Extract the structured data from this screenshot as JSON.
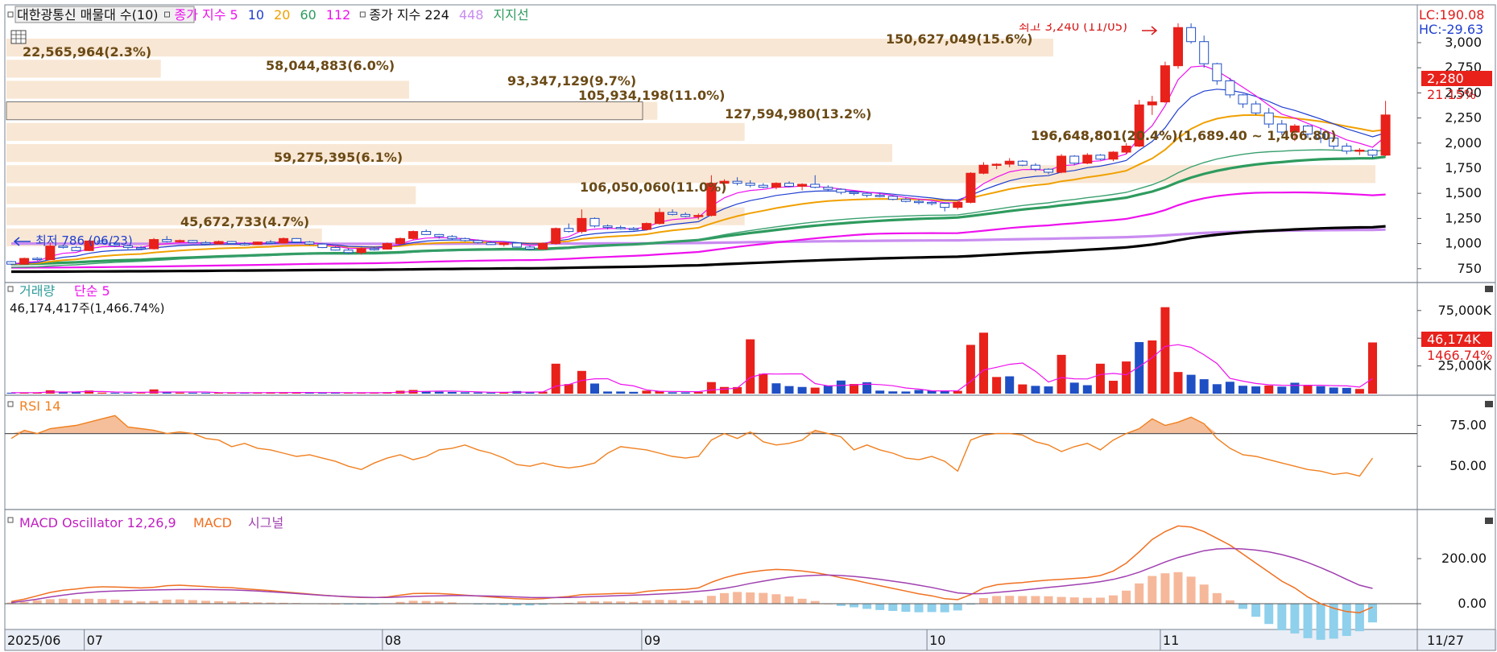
{
  "colors": {
    "up": "#e8211b",
    "down": "#1f4fc4",
    "pink": "#ee11ee",
    "blue": "#1f3fd0",
    "orange": "#f0a000",
    "green": "#2e9b5e",
    "green2": "#3aa070",
    "purple": "#c98cf0",
    "black": "#000000",
    "rsi": "#f08020",
    "macd": "#f07020",
    "signal": "#a040b0",
    "osc_pos": "#f6b89a",
    "osc_neg": "#8fd0ec",
    "box": "#f7e4cf",
    "boxtext": "#6b4a16"
  },
  "header": {
    "items": [
      {
        "text": "대한광통신 매물대 수(10)",
        "color": "#111111"
      },
      {
        "text": "종가 지수 5",
        "color": "#ee11ee"
      },
      {
        "text": "10",
        "color": "#1f3fd0"
      },
      {
        "text": "20",
        "color": "#f0a000"
      },
      {
        "text": "60",
        "color": "#2e9b5e"
      },
      {
        "text": "112",
        "color": "#ee11ee"
      },
      {
        "text": "종가 지수 224",
        "color": "#111111"
      },
      {
        "text": "448",
        "color": "#c98cf0"
      },
      {
        "text": "지지선",
        "color": "#2e9b5e"
      }
    ]
  },
  "right_labels": {
    "lc": "LC:190.08",
    "hc": "HC:-29.63",
    "last_price": "2,280",
    "last_change": "21.15%",
    "vol_last": "46,174K",
    "vol_pct": "1466.74%"
  },
  "price_axis": {
    "ticks": [
      {
        "v": 3000,
        "label": "3,000"
      },
      {
        "v": 2750,
        "label": "2,750"
      },
      {
        "v": 2500,
        "label": "2,500"
      },
      {
        "v": 2250,
        "label": "2,250"
      },
      {
        "v": 2000,
        "label": "2,000"
      },
      {
        "v": 1750,
        "label": "1,750"
      },
      {
        "v": 1500,
        "label": "1,500"
      },
      {
        "v": 1250,
        "label": "1,250"
      },
      {
        "v": 1000,
        "label": "1,000"
      },
      {
        "v": 750,
        "label": "750"
      }
    ]
  },
  "annotations": {
    "high": "최고 3,240 (11/05)",
    "low": "최저 786 (06/23)",
    "support": "196,648,801(20.4%)(1,689.40 ~ 1,466.80)"
  },
  "volume_profile": [
    {
      "label": "150,627,049(15.6%)",
      "pct": 15.6
    },
    {
      "label": "22,565,964(2.3%)",
      "pct": 2.3
    },
    {
      "label": "58,044,883(6.0%)",
      "pct": 6.0
    },
    {
      "label": "93,347,129(9.7%)",
      "pct": 9.7
    },
    {
      "label": "105,934,198(11.0%)",
      "pct": 11.0
    },
    {
      "label": "127,594,980(13.2%)",
      "pct": 13.2
    },
    {
      "label": "196,648,801(20.4%)",
      "pct": 20.4
    },
    {
      "label": "59,275,395(6.1%)",
      "pct": 6.1
    },
    {
      "label": "106,050,060(11.0%)",
      "pct": 11.0
    },
    {
      "label": "45,672,733(4.7%)",
      "pct": 4.7
    }
  ],
  "volume_panel": {
    "title": "거래량",
    "ma": "단순 5",
    "info": "46,174,417주(1,466.74%)",
    "ticks": [
      {
        "v": 75000,
        "label": "75,000K"
      },
      {
        "v": 50000,
        "label": "50,000K"
      },
      {
        "v": 25000,
        "label": "25,000K"
      }
    ]
  },
  "rsi_panel": {
    "title": "RSI 14",
    "ticks": [
      {
        "v": 75,
        "label": "75.00"
      },
      {
        "v": 50,
        "label": "50.00"
      }
    ]
  },
  "macd_panel": {
    "title": "MACD Oscillator 12,26,9",
    "macd": "MACD",
    "signal": "시그널",
    "ticks": [
      {
        "v": 200,
        "label": "200.00"
      },
      {
        "v": 0,
        "label": "0.00"
      }
    ]
  },
  "x_axis": {
    "labels": [
      {
        "i": 0,
        "label": "2025/06"
      },
      {
        "i": 6,
        "label": "07"
      },
      {
        "i": 29,
        "label": "08"
      },
      {
        "i": 49,
        "label": "09"
      },
      {
        "i": 71,
        "label": "10"
      },
      {
        "i": 89,
        "label": "11"
      }
    ],
    "end_label": "11/27"
  },
  "chart_data": {
    "type": "candlestick",
    "title": "대한광통신",
    "x_start": "2025/06",
    "x_end": "11/27",
    "ylim": [
      620,
      3200
    ],
    "candles": [
      [
        820,
        826,
        785,
        795
      ],
      [
        795,
        860,
        790,
        852
      ],
      [
        852,
        865,
        830,
        840
      ],
      [
        840,
        1010,
        835,
        975
      ],
      [
        975,
        990,
        950,
        962
      ],
      [
        962,
        975,
        925,
        930
      ],
      [
        930,
        1035,
        925,
        1025
      ],
      [
        1025,
        1040,
        1000,
        1005
      ],
      [
        1005,
        1015,
        965,
        978
      ],
      [
        978,
        990,
        945,
        960
      ],
      [
        960,
        975,
        935,
        948
      ],
      [
        948,
        1055,
        940,
        1040
      ],
      [
        1040,
        1075,
        1010,
        1020
      ],
      [
        1020,
        1040,
        1010,
        1030
      ],
      [
        1030,
        1035,
        1005,
        1010
      ],
      [
        1010,
        1025,
        990,
        996
      ],
      [
        996,
        1030,
        990,
        1020
      ],
      [
        1020,
        1025,
        995,
        1000
      ],
      [
        1000,
        1015,
        980,
        990
      ],
      [
        990,
        1020,
        985,
        1015
      ],
      [
        1015,
        1035,
        1000,
        1005
      ],
      [
        1005,
        1060,
        1000,
        1050
      ],
      [
        1050,
        1055,
        1010,
        1015
      ],
      [
        1015,
        1025,
        985,
        995
      ],
      [
        995,
        1000,
        955,
        960
      ],
      [
        960,
        970,
        930,
        935
      ],
      [
        935,
        950,
        900,
        910
      ],
      [
        910,
        960,
        890,
        950
      ],
      [
        950,
        960,
        930,
        945
      ],
      [
        945,
        1010,
        940,
        1000
      ],
      [
        1000,
        1060,
        990,
        1050
      ],
      [
        1050,
        1130,
        1040,
        1120
      ],
      [
        1120,
        1140,
        1085,
        1090
      ],
      [
        1090,
        1095,
        1050,
        1070
      ],
      [
        1070,
        1085,
        1040,
        1050
      ],
      [
        1050,
        1060,
        1020,
        1030
      ],
      [
        1030,
        1040,
        1000,
        1010
      ],
      [
        1010,
        1020,
        985,
        990
      ],
      [
        990,
        1015,
        970,
        1005
      ],
      [
        1005,
        1010,
        960,
        965
      ],
      [
        965,
        980,
        935,
        945
      ],
      [
        945,
        1010,
        940,
        1000
      ],
      [
        1000,
        1160,
        990,
        1150
      ],
      [
        1150,
        1200,
        1110,
        1120
      ],
      [
        1120,
        1340,
        1100,
        1250
      ],
      [
        1250,
        1260,
        1160,
        1175
      ],
      [
        1175,
        1190,
        1140,
        1160
      ],
      [
        1160,
        1180,
        1140,
        1150
      ],
      [
        1150,
        1165,
        1130,
        1140
      ],
      [
        1140,
        1210,
        1130,
        1200
      ],
      [
        1200,
        1350,
        1190,
        1310
      ],
      [
        1310,
        1340,
        1280,
        1290
      ],
      [
        1290,
        1310,
        1260,
        1270
      ],
      [
        1270,
        1300,
        1240,
        1280
      ],
      [
        1280,
        1680,
        1270,
        1600
      ],
      [
        1600,
        1640,
        1550,
        1620
      ],
      [
        1620,
        1660,
        1580,
        1600
      ],
      [
        1600,
        1630,
        1560,
        1580
      ],
      [
        1580,
        1600,
        1550,
        1560
      ],
      [
        1560,
        1610,
        1540,
        1600
      ],
      [
        1600,
        1620,
        1560,
        1570
      ],
      [
        1570,
        1600,
        1530,
        1590
      ],
      [
        1590,
        1680,
        1550,
        1560
      ],
      [
        1560,
        1580,
        1520,
        1540
      ],
      [
        1540,
        1550,
        1490,
        1510
      ],
      [
        1510,
        1520,
        1480,
        1500
      ],
      [
        1500,
        1510,
        1460,
        1480
      ],
      [
        1480,
        1500,
        1460,
        1470
      ],
      [
        1470,
        1480,
        1430,
        1440
      ],
      [
        1440,
        1460,
        1410,
        1420
      ],
      [
        1420,
        1440,
        1390,
        1410
      ],
      [
        1410,
        1420,
        1380,
        1400
      ],
      [
        1400,
        1410,
        1320,
        1360
      ],
      [
        1360,
        1420,
        1340,
        1410
      ],
      [
        1410,
        1710,
        1400,
        1700
      ],
      [
        1700,
        1810,
        1690,
        1780
      ],
      [
        1780,
        1800,
        1740,
        1790
      ],
      [
        1790,
        1850,
        1760,
        1820
      ],
      [
        1820,
        1830,
        1770,
        1780
      ],
      [
        1780,
        1800,
        1720,
        1740
      ],
      [
        1740,
        1750,
        1690,
        1710
      ],
      [
        1710,
        1890,
        1700,
        1870
      ],
      [
        1870,
        1880,
        1780,
        1800
      ],
      [
        1800,
        1900,
        1790,
        1880
      ],
      [
        1880,
        1890,
        1830,
        1840
      ],
      [
        1840,
        1920,
        1820,
        1910
      ],
      [
        1910,
        2000,
        1890,
        1970
      ],
      [
        1970,
        2430,
        1960,
        2380
      ],
      [
        2380,
        2470,
        2280,
        2410
      ],
      [
        2410,
        2810,
        2400,
        2770
      ],
      [
        2770,
        3240,
        2740,
        3150
      ],
      [
        3150,
        3260,
        2990,
        3010
      ],
      [
        3010,
        3070,
        2750,
        2790
      ],
      [
        2790,
        2800,
        2580,
        2620
      ],
      [
        2620,
        2650,
        2450,
        2480
      ],
      [
        2480,
        2490,
        2350,
        2390
      ],
      [
        2390,
        2420,
        2280,
        2300
      ],
      [
        2300,
        2350,
        2150,
        2190
      ],
      [
        2190,
        2230,
        2080,
        2110
      ],
      [
        2110,
        2190,
        2020,
        2170
      ],
      [
        2170,
        2180,
        2050,
        2090
      ],
      [
        2090,
        2150,
        2000,
        2050
      ],
      [
        2050,
        2060,
        1940,
        1970
      ],
      [
        1970,
        2000,
        1890,
        1920
      ],
      [
        1920,
        1950,
        1880,
        1930
      ],
      [
        1930,
        1940,
        1850,
        1880
      ],
      [
        1880,
        2420,
        1870,
        2280
      ]
    ],
    "volume_k": [
      800,
      1000,
      900,
      3000,
      1400,
      1200,
      2800,
      900,
      800,
      700,
      600,
      3800,
      1200,
      900,
      800,
      700,
      1000,
      900,
      700,
      1100,
      900,
      1200,
      1100,
      900,
      800,
      700,
      700,
      900,
      800,
      1300,
      2600,
      3300,
      2200,
      1700,
      1500,
      1200,
      1000,
      900,
      1300,
      2300,
      1400,
      1800,
      27000,
      8600,
      20500,
      9100,
      1900,
      1900,
      1600,
      2700,
      2300,
      1200,
      1100,
      1500,
      10400,
      6000,
      5900,
      49000,
      17900,
      9300,
      6800,
      6000,
      5400,
      7200,
      11800,
      8700,
      10300,
      2700,
      2000,
      1900,
      3300,
      2700,
      2300,
      2500,
      44000,
      55000,
      15000,
      15600,
      8300,
      7000,
      6500,
      35000,
      9900,
      7600,
      27000,
      11600,
      29000,
      46500,
      48000,
      78000,
      19500,
      17000,
      13000,
      8500,
      10700,
      7100,
      6500,
      7300,
      6300,
      9800,
      7800,
      6700,
      5500,
      5200,
      4200,
      46174
    ],
    "volume_down_indices": [
      0,
      4,
      5,
      8,
      9,
      12,
      14,
      15,
      18,
      23,
      24,
      25,
      32,
      33,
      34,
      35,
      36,
      37,
      39,
      40,
      45,
      46,
      47,
      48,
      51,
      52,
      59,
      60,
      61,
      63,
      64,
      66,
      67,
      68,
      69,
      70,
      71,
      72,
      77,
      79,
      80,
      82,
      83,
      87,
      91,
      92,
      93,
      94,
      95,
      96,
      98,
      99,
      101,
      102,
      103
    ],
    "rsi": [
      67,
      72,
      70,
      73,
      74,
      75,
      77,
      79,
      81,
      74,
      73,
      72,
      70,
      71,
      70,
      67,
      66,
      62,
      64,
      61,
      60,
      58,
      56,
      57,
      55,
      53,
      50,
      48,
      52,
      55,
      57,
      54,
      56,
      60,
      61,
      63,
      60,
      58,
      55,
      51,
      50,
      52,
      50,
      49,
      50,
      52,
      58,
      62,
      61,
      60,
      58,
      56,
      55,
      56,
      66,
      70,
      67,
      71,
      65,
      63,
      64,
      66,
      72,
      70,
      68,
      60,
      63,
      60,
      58,
      55,
      54,
      56,
      53,
      47,
      66,
      69,
      70,
      70,
      69,
      65,
      63,
      59,
      62,
      64,
      60,
      66,
      70,
      73,
      79,
      75,
      77,
      80,
      76,
      67,
      61,
      57,
      56,
      54,
      52,
      50,
      48,
      47,
      45,
      46,
      44,
      55
    ],
    "macd": [
      10,
      20,
      35,
      50,
      60,
      65,
      72,
      75,
      74,
      72,
      70,
      73,
      80,
      82,
      79,
      76,
      73,
      71,
      66,
      62,
      58,
      53,
      48,
      43,
      38,
      34,
      30,
      28,
      27,
      30,
      38,
      45,
      46,
      45,
      42,
      38,
      34,
      30,
      26,
      22,
      20,
      22,
      28,
      32,
      40,
      42,
      44,
      46,
      46,
      55,
      60,
      62,
      64,
      70,
      95,
      115,
      130,
      140,
      148,
      152,
      150,
      145,
      138,
      128,
      115,
      105,
      92,
      80,
      68,
      56,
      44,
      35,
      22,
      18,
      40,
      70,
      84,
      90,
      94,
      100,
      105,
      108,
      112,
      116,
      125,
      145,
      180,
      230,
      285,
      320,
      345,
      340,
      320,
      290,
      260,
      220,
      180,
      140,
      100,
      70,
      30,
      0,
      -20,
      -35,
      -40,
      -15
    ],
    "signal": [
      5,
      12,
      20,
      30,
      38,
      45,
      50,
      54,
      56,
      58,
      60,
      61,
      62,
      63,
      63,
      63,
      62,
      61,
      59,
      56,
      53,
      49,
      45,
      41,
      37,
      34,
      31,
      29,
      28,
      28,
      30,
      32,
      34,
      35,
      36,
      36,
      35,
      34,
      32,
      30,
      28,
      27,
      27,
      28,
      30,
      32,
      34,
      36,
      38,
      40,
      43,
      46,
      50,
      55,
      60,
      68,
      78,
      90,
      100,
      110,
      118,
      123,
      126,
      127,
      125,
      121,
      115,
      108,
      100,
      92,
      82,
      72,
      60,
      48,
      44,
      45,
      50,
      55,
      60,
      66,
      72,
      78,
      84,
      90,
      98,
      108,
      122,
      140,
      162,
      185,
      205,
      220,
      235,
      243,
      245,
      243,
      238,
      230,
      218,
      202,
      183,
      160,
      135,
      108,
      82,
      68
    ]
  }
}
